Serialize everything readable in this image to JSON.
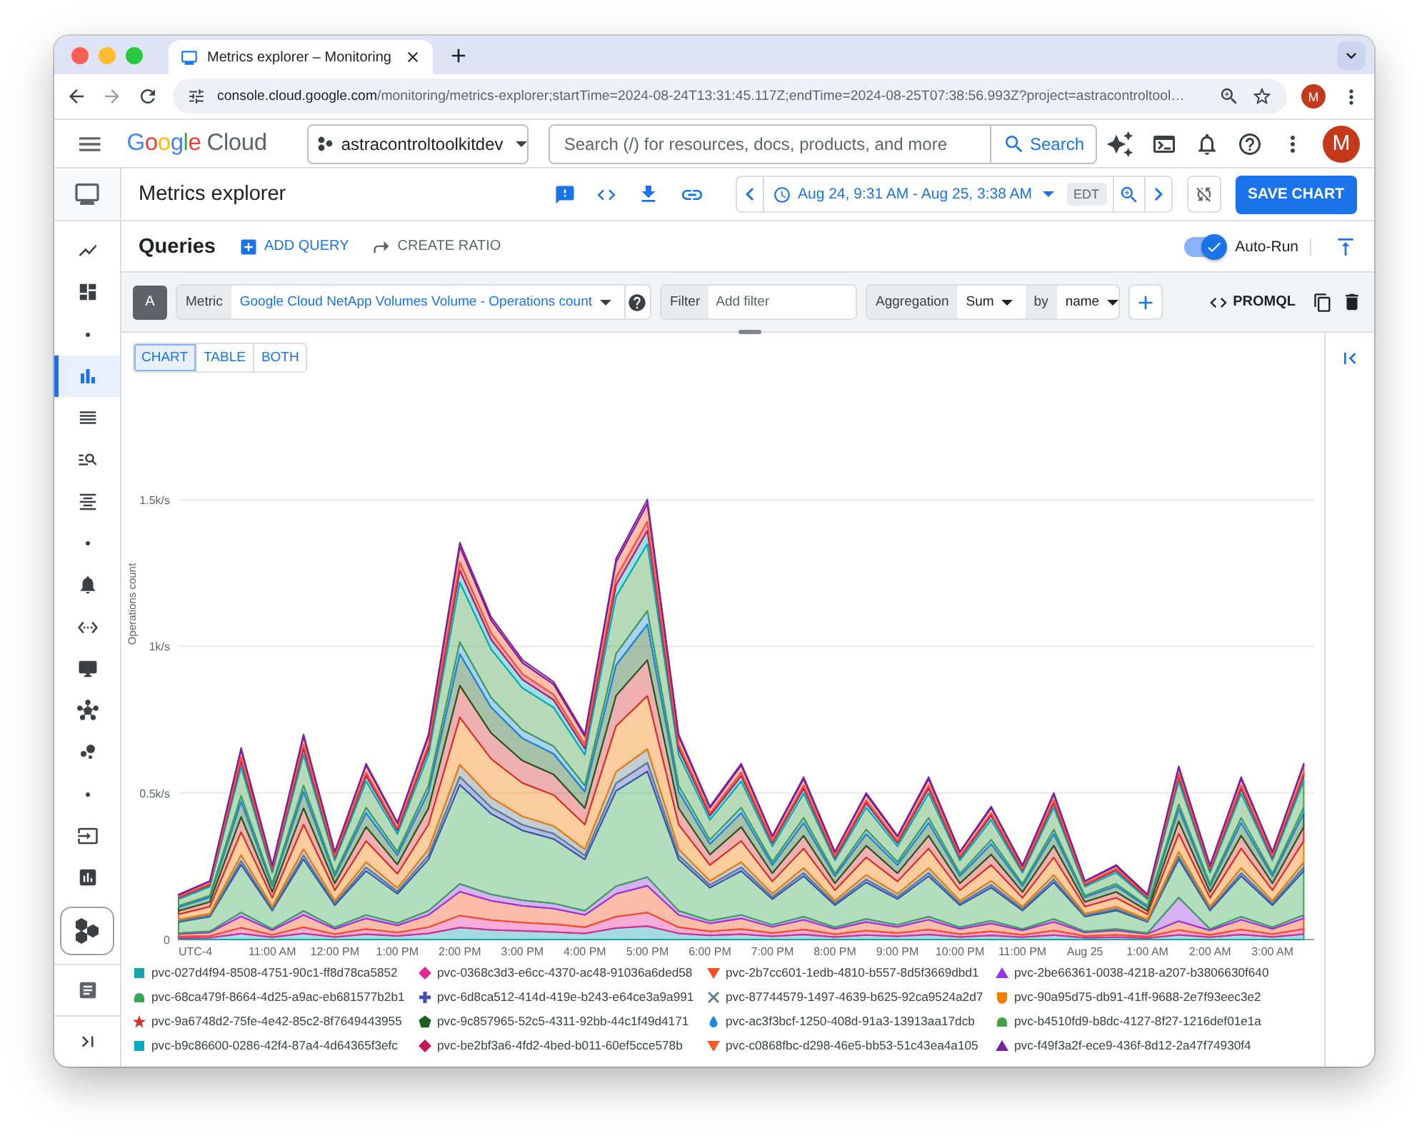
{
  "browser": {
    "tab_title": "Metrics explorer – Monitoring",
    "url_host": "console.cloud.google.com",
    "url_path": "/monitoring/metrics-explorer;startTime=2024-08-24T13:31:45.117Z;endTime=2024-08-25T07:38:56.993Z?project=astracontroltool…",
    "profile_initial": "M"
  },
  "header": {
    "logo_word": "Google",
    "logo_product": "Cloud",
    "project": "astracontroltoolkitdev",
    "search_placeholder": "Search (/) for resources, docs, products, and more",
    "search_button": "Search",
    "avatar_initial": "M"
  },
  "sidebar": {
    "items": [
      {
        "selected": false
      },
      {
        "selected": false
      },
      {
        "selected": true
      },
      {
        "selected": false
      },
      {
        "selected": false
      },
      {
        "selected": false
      },
      {
        "selected": false
      },
      {
        "selected": false
      },
      {
        "selected": false
      },
      {
        "selected": false
      },
      {
        "selected": false
      },
      {
        "selected": false
      },
      {
        "selected": false
      }
    ]
  },
  "page": {
    "title": "Metrics explorer",
    "time_range": "Aug 24, 9:31 AM - Aug 25, 3:38 AM",
    "timezone": "EDT",
    "save_button": "SAVE CHART"
  },
  "queries": {
    "title": "Queries",
    "add_query": "ADD QUERY",
    "create_ratio": "CREATE RATIO",
    "auto_run": {
      "label": "Auto-Run",
      "on": true
    }
  },
  "query": {
    "letter": "A",
    "metric_label": "Metric",
    "metric": "Google Cloud NetApp Volumes Volume - Operations count",
    "filter_label": "Filter",
    "filter_placeholder": "Add filter",
    "aggregation_label": "Aggregation",
    "aggregation": "Sum",
    "by_label": "by",
    "group_by": "name",
    "promql": "PROMQL"
  },
  "view_tabs": [
    {
      "label": "CHART",
      "selected": true
    },
    {
      "label": "TABLE",
      "selected": false
    },
    {
      "label": "BOTH",
      "selected": false
    }
  ],
  "chart": {
    "timezone_label": "UTC-4",
    "legend": [
      {
        "kind": "square"
      },
      {
        "kind": "diamond"
      },
      {
        "kind": "triangle-down"
      },
      {
        "kind": "triangle-up"
      },
      {
        "kind": "dome"
      },
      {
        "kind": "cross"
      },
      {
        "kind": "x"
      },
      {
        "kind": "shield"
      },
      {
        "kind": "star"
      },
      {
        "kind": "pentagon"
      },
      {
        "kind": "drop"
      },
      {
        "kind": "dome"
      },
      {
        "kind": "square"
      },
      {
        "kind": "diamond"
      },
      {
        "kind": "triangle-down"
      },
      {
        "kind": "triangle-up"
      }
    ],
    "chart_data": {
      "type": "area",
      "stacked": true,
      "grid": true,
      "ylabel": "Operations count",
      "ylim": [
        0,
        1500
      ],
      "xlim": [
        "2024-08-24T09:30",
        "2024-08-25T03:40"
      ],
      "x": [
        "2024-08-24T09:30",
        "2024-08-24T10:00",
        "2024-08-24T10:30",
        "2024-08-24T11:00",
        "2024-08-24T11:30",
        "2024-08-24T12:00",
        "2024-08-24T12:30",
        "2024-08-24T13:00",
        "2024-08-24T13:30",
        "2024-08-24T14:00",
        "2024-08-24T14:30",
        "2024-08-24T15:00",
        "2024-08-24T15:30",
        "2024-08-24T16:00",
        "2024-08-24T16:30",
        "2024-08-24T17:00",
        "2024-08-24T17:30",
        "2024-08-24T18:00",
        "2024-08-24T18:30",
        "2024-08-24T19:00",
        "2024-08-24T19:30",
        "2024-08-24T20:00",
        "2024-08-24T20:30",
        "2024-08-24T21:00",
        "2024-08-24T21:30",
        "2024-08-24T22:00",
        "2024-08-24T22:30",
        "2024-08-24T23:00",
        "2024-08-24T23:30",
        "2024-08-25T00:00",
        "2024-08-25T00:30",
        "2024-08-25T01:00",
        "2024-08-25T01:30",
        "2024-08-25T02:00",
        "2024-08-25T02:30",
        "2024-08-25T03:00",
        "2024-08-25T03:30"
      ],
      "xticks": [
        {
          "value": "2024-08-24T11:00",
          "label": "11:00 AM"
        },
        {
          "value": "2024-08-24T12:00",
          "label": "12:00 PM"
        },
        {
          "value": "2024-08-24T13:00",
          "label": "1:00 PM"
        },
        {
          "value": "2024-08-24T14:00",
          "label": "2:00 PM"
        },
        {
          "value": "2024-08-24T15:00",
          "label": "3:00 PM"
        },
        {
          "value": "2024-08-24T16:00",
          "label": "4:00 PM"
        },
        {
          "value": "2024-08-24T17:00",
          "label": "5:00 PM"
        },
        {
          "value": "2024-08-24T18:00",
          "label": "6:00 PM"
        },
        {
          "value": "2024-08-24T19:00",
          "label": "7:00 PM"
        },
        {
          "value": "2024-08-24T20:00",
          "label": "8:00 PM"
        },
        {
          "value": "2024-08-24T21:00",
          "label": "9:00 PM"
        },
        {
          "value": "2024-08-24T22:00",
          "label": "10:00 PM"
        },
        {
          "value": "2024-08-24T23:00",
          "label": "11:00 PM"
        },
        {
          "value": "2024-08-25T00:00",
          "label": "Aug 25"
        },
        {
          "value": "2024-08-25T01:00",
          "label": "1:00 AM"
        },
        {
          "value": "2024-08-25T02:00",
          "label": "2:00 AM"
        },
        {
          "value": "2024-08-25T03:00",
          "label": "3:00 AM"
        }
      ],
      "yticks": [
        {
          "value": 0,
          "label": "0"
        },
        {
          "value": 500,
          "label": "0.5k/s"
        },
        {
          "value": 1000,
          "label": "1k/s"
        },
        {
          "value": 1500,
          "label": "1.5k/s"
        }
      ],
      "series": [
        {
          "name": "pvc-027d4f94-8508-4751-90c1-ff8d78ca5852",
          "color": "#12a4af",
          "values": [
            5,
            6,
            20,
            8,
            21,
            9,
            18,
            12,
            21,
            41,
            33,
            29,
            26,
            21,
            39,
            46,
            21,
            14,
            18,
            11,
            17,
            9,
            15,
            11,
            17,
            9,
            14,
            8,
            15,
            6,
            8,
            5,
            16,
            8,
            17,
            9,
            18
          ]
        },
        {
          "name": "pvc-0368c3d3-e6cc-4370-ac48-91036a6ded58",
          "color": "#e52592",
          "values": [
            5,
            6,
            20,
            8,
            21,
            9,
            18,
            12,
            21,
            41,
            33,
            29,
            26,
            21,
            39,
            46,
            21,
            14,
            18,
            11,
            17,
            9,
            15,
            11,
            17,
            9,
            14,
            8,
            15,
            6,
            8,
            5,
            16,
            8,
            17,
            9,
            18
          ]
        },
        {
          "name": "pvc-2b7cc601-1edb-4810-b557-8d5f3669dbd1",
          "color": "#f4511e",
          "values": [
            9,
            12,
            39,
            15,
            42,
            18,
            36,
            24,
            42,
            81,
            66,
            57,
            53,
            42,
            78,
            91,
            42,
            27,
            36,
            21,
            33,
            18,
            30,
            21,
            33,
            18,
            27,
            15,
            30,
            12,
            15,
            9,
            31,
            15,
            33,
            18,
            36
          ]
        },
        {
          "name": "pvc-2be66361-0038-4218-a207-b3806630f640",
          "color": "#9334e6",
          "values": [
            3,
            4,
            13,
            5,
            14,
            6,
            12,
            8,
            14,
            27,
            22,
            19,
            18,
            14,
            26,
            30,
            14,
            9,
            12,
            7,
            11,
            6,
            10,
            7,
            11,
            6,
            9,
            5,
            10,
            4,
            5,
            3,
            80,
            5,
            11,
            6,
            12
          ]
        },
        {
          "name": "pvc-68ca479f-8664-4d25-a9ac-eb681577b2b1",
          "color": "#34a853",
          "values": [
            38,
            50,
            163,
            63,
            175,
            75,
            150,
            100,
            175,
            338,
            275,
            238,
            220,
            175,
            325,
            360,
            175,
            113,
            150,
            88,
            138,
            75,
            125,
            88,
            138,
            75,
            113,
            63,
            125,
            50,
            63,
            38,
            130,
            63,
            138,
            75,
            150
          ]
        },
        {
          "name": "pvc-6d8ca512-414d-419e-b243-e64ce3a9a991",
          "color": "#3f51b5",
          "values": [
            3,
            4,
            13,
            5,
            14,
            6,
            12,
            8,
            14,
            27,
            22,
            19,
            18,
            14,
            26,
            30,
            14,
            9,
            12,
            7,
            11,
            6,
            10,
            7,
            11,
            6,
            9,
            5,
            10,
            4,
            5,
            3,
            10,
            5,
            11,
            6,
            12
          ]
        },
        {
          "name": "pvc-87744579-1497-4639-b625-92ca9524a2d7",
          "color": "#607d8b",
          "values": [
            5,
            6,
            20,
            8,
            21,
            9,
            18,
            12,
            21,
            41,
            33,
            29,
            26,
            21,
            39,
            46,
            21,
            14,
            18,
            11,
            17,
            9,
            15,
            11,
            17,
            9,
            14,
            8,
            15,
            6,
            8,
            5,
            16,
            8,
            17,
            9,
            18
          ]
        },
        {
          "name": "pvc-90a95d75-db91-41ff-9688-2e7f93eec3e2",
          "color": "#f57c00",
          "values": [
            18,
            24,
            78,
            30,
            84,
            36,
            72,
            48,
            84,
            162,
            132,
            114,
            106,
            84,
            156,
            182,
            84,
            54,
            72,
            42,
            66,
            36,
            60,
            42,
            66,
            36,
            54,
            30,
            60,
            24,
            30,
            18,
            62,
            30,
            66,
            36,
            72
          ]
        },
        {
          "name": "pvc-9a6748d2-75fe-4e42-85c2-8f7649443955",
          "color": "#d32f2f",
          "values": [
            12,
            16,
            52,
            20,
            56,
            24,
            48,
            32,
            56,
            108,
            88,
            76,
            70,
            56,
            104,
            122,
            56,
            36,
            48,
            28,
            44,
            24,
            40,
            28,
            44,
            24,
            36,
            20,
            40,
            16,
            20,
            12,
            42,
            20,
            44,
            24,
            48
          ]
        },
        {
          "name": "pvc-9c857965-52c5-4311-92bb-44c1f49d4171",
          "color": "#1b5e20",
          "values": [
            12,
            16,
            52,
            20,
            56,
            24,
            48,
            32,
            56,
            108,
            88,
            76,
            70,
            56,
            104,
            122,
            56,
            36,
            48,
            28,
            44,
            24,
            40,
            28,
            44,
            24,
            36,
            20,
            40,
            16,
            20,
            12,
            42,
            20,
            44,
            24,
            48
          ]
        },
        {
          "name": "pvc-ac3f3bcf-1250-408d-91a3-13913aa17dcb",
          "color": "#1e88e5",
          "values": [
            5,
            6,
            20,
            8,
            21,
            9,
            18,
            12,
            21,
            41,
            33,
            29,
            26,
            21,
            39,
            46,
            21,
            14,
            18,
            11,
            17,
            9,
            15,
            11,
            17,
            9,
            14,
            8,
            15,
            6,
            8,
            5,
            16,
            8,
            17,
            9,
            18
          ]
        },
        {
          "name": "pvc-b4510fd9-b8dc-4127-8f27-1216def01e1a",
          "color": "#43a047",
          "values": [
            23,
            30,
            98,
            38,
            105,
            45,
            90,
            60,
            105,
            203,
            165,
            143,
            132,
            105,
            195,
            228,
            105,
            68,
            90,
            53,
            83,
            45,
            75,
            53,
            83,
            45,
            68,
            38,
            75,
            30,
            38,
            23,
            78,
            38,
            83,
            45,
            90
          ]
        },
        {
          "name": "pvc-b9c86600-0286-42f4-87a4-4d64365f3efc",
          "color": "#00acc1",
          "values": [
            5,
            6,
            20,
            8,
            21,
            9,
            18,
            12,
            21,
            41,
            33,
            29,
            26,
            21,
            39,
            46,
            21,
            14,
            18,
            11,
            17,
            9,
            15,
            11,
            17,
            9,
            14,
            8,
            15,
            6,
            8,
            5,
            16,
            8,
            17,
            9,
            18
          ]
        },
        {
          "name": "pvc-be2bf3a6-4fd2-4bed-b011-60ef5cce578b",
          "color": "#c2185b",
          "values": [
            3,
            4,
            13,
            5,
            14,
            6,
            12,
            8,
            14,
            27,
            22,
            19,
            18,
            14,
            26,
            30,
            14,
            9,
            12,
            7,
            11,
            6,
            10,
            7,
            11,
            6,
            9,
            5,
            10,
            4,
            5,
            3,
            10,
            5,
            11,
            6,
            12
          ]
        },
        {
          "name": "pvc-c0868fbc-d298-46e5-bb53-51c43ea4a105",
          "color": "#ff5722",
          "values": [
            6,
            8,
            26,
            10,
            28,
            12,
            24,
            16,
            28,
            54,
            44,
            38,
            35,
            28,
            52,
            61,
            28,
            18,
            24,
            14,
            22,
            12,
            20,
            14,
            22,
            12,
            18,
            10,
            20,
            8,
            10,
            6,
            21,
            10,
            22,
            12,
            24
          ]
        },
        {
          "name": "pvc-f49f3a2f-ece9-436f-8d12-2a47f74930f4",
          "color": "#7b1fa2",
          "values": [
            2,
            2,
            7,
            3,
            7,
            3,
            6,
            4,
            7,
            14,
            11,
            10,
            9,
            7,
            13,
            15,
            7,
            5,
            6,
            4,
            6,
            3,
            5,
            4,
            6,
            3,
            5,
            3,
            5,
            2,
            3,
            2,
            5,
            3,
            6,
            3,
            6
          ]
        }
      ]
    }
  }
}
